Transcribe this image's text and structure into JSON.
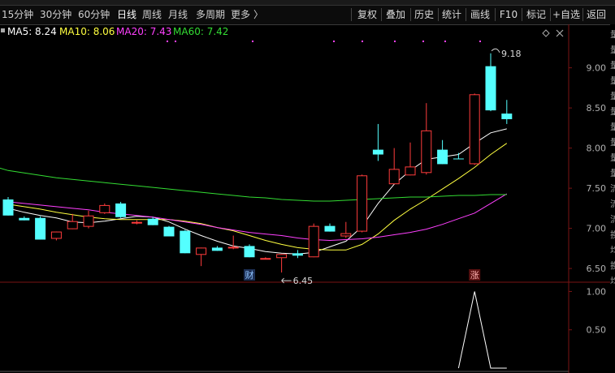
{
  "toolbar": {
    "periods": [
      "15分钟",
      "30分钟",
      "60分钟",
      "日线",
      "周线",
      "月线",
      "多周期",
      "更多"
    ],
    "active_period": "日线",
    "more_arrow": "〉",
    "actions": [
      "复权",
      "叠加",
      "历史",
      "统计",
      "画线",
      "F10",
      "标记",
      "+自选",
      "返回"
    ]
  },
  "indicators": {
    "ma5": {
      "label": "MA5: 8.24",
      "color": "#ffffff"
    },
    "ma10": {
      "label": "MA10: 8.06",
      "color": "#ffff40"
    },
    "ma20": {
      "label": "MA20: 7.43",
      "color": "#ff40ff"
    },
    "ma60": {
      "label": "MA60: 7.42",
      "color": "#33dd33"
    }
  },
  "colors": {
    "up": "#ff3c3c",
    "down": "#54ffff",
    "axis": "#7a1414",
    "tick_text": "#b0b0b0",
    "annotation": "#d8d8d8",
    "sub_line": "#ffffff"
  },
  "markers": {
    "cai": "财",
    "zhang": "涨"
  },
  "right_labels": [
    "量",
    "量",
    "量",
    "量",
    "量",
    "量",
    "量",
    "量",
    "量",
    "量",
    "流",
    "流",
    "流",
    "换",
    "均",
    "换",
    "均"
  ],
  "chart_data": [
    {
      "type": "candlestick",
      "title": "",
      "ylim": [
        6.38,
        9.38
      ],
      "yticks": [
        "9.00",
        "8.50",
        "8.00",
        "7.50",
        "7.00",
        "6.50"
      ],
      "grid": false,
      "candles": [
        {
          "o": 7.36,
          "h": 7.39,
          "l": 7.16,
          "c": 7.16
        },
        {
          "o": 7.13,
          "h": 7.15,
          "l": 7.1,
          "c": 7.1
        },
        {
          "o": 7.13,
          "h": 7.15,
          "l": 6.86,
          "c": 6.86
        },
        {
          "o": 6.87,
          "h": 6.96,
          "l": 6.85,
          "c": 6.96
        },
        {
          "o": 6.99,
          "h": 7.18,
          "l": 6.99,
          "c": 7.09
        },
        {
          "o": 7.02,
          "h": 7.22,
          "l": 7.0,
          "c": 7.16
        },
        {
          "o": 7.19,
          "h": 7.31,
          "l": 7.18,
          "c": 7.29
        },
        {
          "o": 7.31,
          "h": 7.33,
          "l": 7.13,
          "c": 7.14
        },
        {
          "o": 7.07,
          "h": 7.1,
          "l": 7.05,
          "c": 7.08
        },
        {
          "o": 7.12,
          "h": 7.14,
          "l": 7.04,
          "c": 7.04
        },
        {
          "o": 7.02,
          "h": 7.03,
          "l": 6.9,
          "c": 6.9
        },
        {
          "o": 6.97,
          "h": 6.98,
          "l": 6.69,
          "c": 6.69
        },
        {
          "o": 6.67,
          "h": 6.76,
          "l": 6.53,
          "c": 6.76
        },
        {
          "o": 6.76,
          "h": 6.78,
          "l": 6.72,
          "c": 6.72
        },
        {
          "o": 6.76,
          "h": 6.91,
          "l": 6.74,
          "c": 6.77
        },
        {
          "o": 6.78,
          "h": 6.8,
          "l": 6.64,
          "c": 6.64
        },
        {
          "o": 6.63,
          "h": 6.64,
          "l": 6.62,
          "c": 6.63
        },
        {
          "o": 6.63,
          "h": 6.68,
          "l": 6.45,
          "c": 6.68
        },
        {
          "o": 6.69,
          "h": 6.73,
          "l": 6.63,
          "c": 6.66
        },
        {
          "o": 6.64,
          "h": 7.06,
          "l": 6.64,
          "c": 7.03
        },
        {
          "o": 7.03,
          "h": 7.06,
          "l": 6.96,
          "c": 6.96
        },
        {
          "o": 6.9,
          "h": 7.08,
          "l": 6.88,
          "c": 6.94
        },
        {
          "o": 6.96,
          "h": 7.67,
          "l": 6.95,
          "c": 7.66
        },
        {
          "o": 7.98,
          "h": 8.3,
          "l": 7.84,
          "c": 7.92
        },
        {
          "o": 7.55,
          "h": 8.0,
          "l": 7.55,
          "c": 7.74
        },
        {
          "o": 7.66,
          "h": 8.07,
          "l": 7.66,
          "c": 7.77
        },
        {
          "o": 7.69,
          "h": 8.56,
          "l": 7.67,
          "c": 8.22
        },
        {
          "o": 7.98,
          "h": 8.1,
          "l": 7.8,
          "c": 7.8
        },
        {
          "o": 7.87,
          "h": 7.94,
          "l": 7.86,
          "c": 7.86
        },
        {
          "o": 7.8,
          "h": 8.68,
          "l": 7.79,
          "c": 8.67
        },
        {
          "o": 9.02,
          "h": 9.18,
          "l": 8.46,
          "c": 8.47
        },
        {
          "o": 8.43,
          "h": 8.6,
          "l": 8.3,
          "c": 8.36
        }
      ],
      "series": [
        {
          "name": "MA5",
          "values": [
            7.25,
            7.2,
            7.16,
            7.13,
            7.08,
            7.07,
            7.09,
            7.12,
            7.15,
            7.14,
            7.08,
            6.99,
            6.91,
            6.84,
            6.78,
            6.75,
            6.71,
            6.69,
            6.68,
            6.7,
            6.77,
            6.84,
            7.02,
            7.31,
            7.55,
            7.72,
            7.86,
            7.89,
            7.92,
            8.06,
            8.19,
            8.24
          ]
        },
        {
          "name": "MA10",
          "values": [
            7.3,
            7.27,
            7.24,
            7.2,
            7.17,
            7.14,
            7.12,
            7.11,
            7.11,
            7.11,
            7.11,
            7.09,
            7.06,
            7.01,
            6.97,
            6.91,
            6.85,
            6.8,
            6.76,
            6.74,
            6.73,
            6.73,
            6.8,
            6.93,
            7.1,
            7.24,
            7.36,
            7.49,
            7.62,
            7.76,
            7.92,
            8.06
          ]
        },
        {
          "name": "MA20",
          "values": [
            7.33,
            7.31,
            7.29,
            7.27,
            7.25,
            7.23,
            7.2,
            7.18,
            7.16,
            7.14,
            7.11,
            7.08,
            7.05,
            7.01,
            6.98,
            6.95,
            6.93,
            6.91,
            6.88,
            6.86,
            6.85,
            6.86,
            6.87,
            6.89,
            6.92,
            6.95,
            6.99,
            7.05,
            7.12,
            7.19,
            7.31,
            7.43
          ]
        },
        {
          "name": "MA60",
          "values": [
            7.72,
            7.69,
            7.66,
            7.63,
            7.61,
            7.59,
            7.57,
            7.55,
            7.53,
            7.51,
            7.49,
            7.47,
            7.45,
            7.43,
            7.41,
            7.39,
            7.38,
            7.36,
            7.35,
            7.34,
            7.34,
            7.35,
            7.36,
            7.37,
            7.38,
            7.39,
            7.39,
            7.4,
            7.41,
            7.41,
            7.42,
            7.42
          ]
        }
      ],
      "annotations": {
        "high": {
          "index": 30,
          "label": "9.18"
        },
        "low": {
          "index": 17,
          "label": "6.45"
        }
      },
      "event_markers": [
        {
          "index": 15,
          "label": "财"
        },
        {
          "index": 29,
          "label": "涨"
        }
      ]
    },
    {
      "type": "line",
      "title": "",
      "ylim": [
        0,
        1.1
      ],
      "yticks": [
        "1.00",
        "0.50"
      ],
      "grid": false,
      "series": [
        {
          "values": [
            0,
            0,
            0,
            0,
            0,
            0,
            0,
            0,
            0,
            0,
            0,
            0,
            0,
            0,
            0,
            0,
            0,
            0,
            0,
            0,
            0,
            0,
            0,
            0,
            0,
            0,
            0,
            0,
            0,
            1,
            0,
            0
          ]
        }
      ]
    }
  ]
}
